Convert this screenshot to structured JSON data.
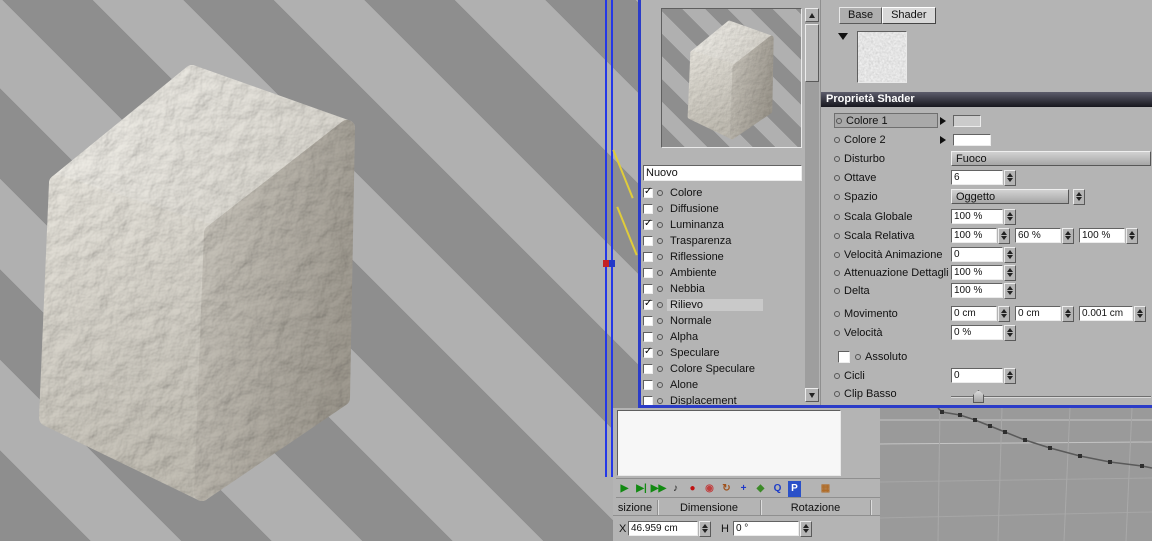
{
  "colors": {
    "window_border": "#2b3cc8",
    "selection_blue": "#2438e8",
    "stripe_dark": "#8e8e8e",
    "stripe_light": "#b0b0b0",
    "channel_highlight": "#c9c9c9",
    "colore1_swatch": "#cbcbcb",
    "colore2_swatch": "#ffffff"
  },
  "material_editor": {
    "name_value": "Nuovo",
    "channels": [
      {
        "label": "Colore",
        "checked": true
      },
      {
        "label": "Diffusione",
        "checked": false
      },
      {
        "label": "Luminanza",
        "checked": true
      },
      {
        "label": "Trasparenza",
        "checked": false
      },
      {
        "label": "Riflessione",
        "checked": false
      },
      {
        "label": "Ambiente",
        "checked": false
      },
      {
        "label": "Nebbia",
        "checked": false
      },
      {
        "label": "Rilievo",
        "checked": true,
        "selected": true
      },
      {
        "label": "Normale",
        "checked": false
      },
      {
        "label": "Alpha",
        "checked": false
      },
      {
        "label": "Speculare",
        "checked": true
      },
      {
        "label": "Colore Speculare",
        "checked": false
      },
      {
        "label": "Alone",
        "checked": false
      },
      {
        "label": "Displacement",
        "checked": false
      }
    ]
  },
  "shader": {
    "tab_base": "Base",
    "tab_shader": "Shader",
    "section_title": "Proprietà Shader",
    "colore1": {
      "label": "Colore 1",
      "swatch": "#cbcbcb"
    },
    "colore2": {
      "label": "Colore 2",
      "swatch": "#ffffff"
    },
    "disturbo": {
      "label": "Disturbo",
      "value": "Fuoco"
    },
    "ottave": {
      "label": "Ottave",
      "value": "6"
    },
    "spazio": {
      "label": "Spazio",
      "value": "Oggetto"
    },
    "scala_globale": {
      "label": "Scala Globale",
      "value": "100 %"
    },
    "scala_relativa": {
      "label": "Scala Relativa",
      "v1": "100 %",
      "v2": "60 %",
      "v3": "100 %"
    },
    "velocita_animazione": {
      "label": "Velocità Animazione",
      "value": "0"
    },
    "attenuazione_dettagli": {
      "label": "Attenuazione Dettagli",
      "value": "100 %"
    },
    "delta": {
      "label": "Delta",
      "value": "100 %"
    },
    "movimento": {
      "label": "Movimento",
      "v1": "0 cm",
      "v2": "0 cm",
      "v3": "0.001 cm"
    },
    "velocita": {
      "label": "Velocità",
      "value": "0 %"
    },
    "assoluto": {
      "label": "Assoluto",
      "checked": false
    },
    "cicli": {
      "label": "Cicli",
      "value": "0"
    },
    "clip_basso": {
      "label": "Clip Basso",
      "slider_pos": "11%"
    }
  },
  "transport": {
    "icons": [
      {
        "name": "play-button",
        "glyph": "▶",
        "color": "#128a12"
      },
      {
        "name": "goto-next-frame-button",
        "glyph": "▶|",
        "color": "#128a12"
      },
      {
        "name": "goto-end-button",
        "glyph": "▶▶",
        "color": "#128a12"
      },
      {
        "name": "sound-button",
        "glyph": "♪",
        "color": "#1c1c1c"
      },
      {
        "name": "record-button",
        "glyph": "●",
        "color": "#c01212"
      },
      {
        "name": "record-objects-button",
        "glyph": "◉",
        "color": "#c04040"
      },
      {
        "name": "autokey-button",
        "glyph": "↻",
        "color": "#a0521c"
      },
      {
        "name": "record-position-button",
        "glyph": "+",
        "color": "#2038c8"
      },
      {
        "name": "record-key-button",
        "glyph": "◆",
        "color": "#3c8a28"
      },
      {
        "name": "q-button",
        "glyph": "Q",
        "color": "#1c3cc8"
      },
      {
        "name": "parameter-button",
        "glyph": "P",
        "color": "#ffffff",
        "bg": "#2a50c8"
      },
      {
        "name": "palette-button",
        "glyph": "▦",
        "color": "#b06c28"
      }
    ]
  },
  "coords": {
    "header_posizione": "sizione",
    "header_dimensione": "Dimensione",
    "header_rotazione": "Rotazione",
    "x_label": "X",
    "x_value": "46.959 cm",
    "h_label": "H",
    "h_value": "0 °"
  }
}
